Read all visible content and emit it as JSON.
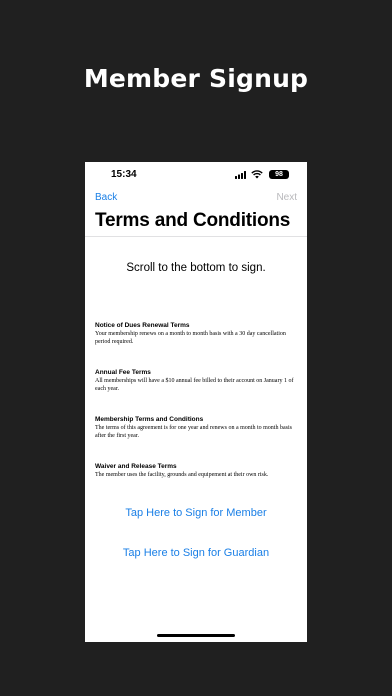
{
  "promo": {
    "title": "Member Signup"
  },
  "status_bar": {
    "time": "15:34",
    "battery": "98"
  },
  "nav": {
    "back_label": "Back",
    "next_label": "Next"
  },
  "header": {
    "title": "Terms and Conditions"
  },
  "content": {
    "scroll_hint": "Scroll to the bottom to sign.",
    "sections": [
      {
        "title": "Notice of Dues Renewal Terms",
        "body": "Your membership renews on a month to month basis with a 30 day cancellation period required."
      },
      {
        "title": "Annual Fee Terms",
        "body": "All memberships will have a $10 annual fee billed to their account on January 1 of each year."
      },
      {
        "title": "Membership Terms and Conditions",
        "body": "The terms of this agreement is for one year and renews on a month to month basis after the first year."
      },
      {
        "title": "Waiver and Release Terms",
        "body": "The member uses the facility, grounds and equipement at their own risk."
      }
    ],
    "sign_member_label": "Tap Here to Sign for Member",
    "sign_guardian_label": "Tap Here to Sign for Guardian"
  },
  "colors": {
    "accent": "#1a7fe6",
    "disabled": "#b9b9bc",
    "background": "#202020"
  }
}
